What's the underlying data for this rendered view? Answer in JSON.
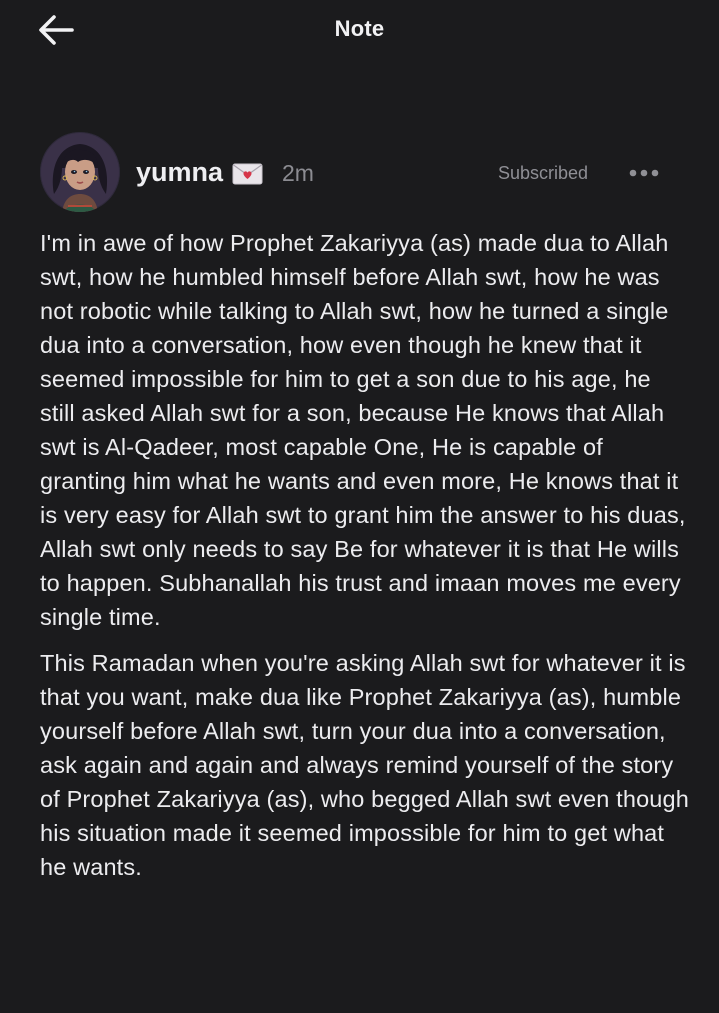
{
  "header": {
    "title": "Note",
    "back_icon": "arrow-left-icon"
  },
  "author": {
    "name": "yumna",
    "badge_icon": "love-letter-icon",
    "timestamp": "2m",
    "subscribed_label": "Subscribed",
    "more_icon": "more-horizontal-icon"
  },
  "note": {
    "paragraphs": [
      "I'm in awe of how Prophet Zakariyya (as) made dua to Allah swt, how he humbled himself before Allah swt, how he was not robotic while talking to Allah swt, how he turned a single dua into a conversation, how even though he knew that it seemed impossible for him to get a son due to his age, he still asked Allah swt for a son, because He knows that Allah swt is Al-Qadeer, most capable One, He is capable of granting him what he wants and even more, He knows that it is very easy for Allah swt to grant him the answer to his duas, Allah swt only needs to say Be for whatever it is that He wills to happen. Subhanallah his trust and imaan moves me every single time.",
      "This Ramadan when you're asking Allah swt for whatever it is that you want, make dua like Prophet Zakariyya (as), humble yourself before Allah swt, turn your dua into a conversation, ask again and again and always remind yourself of the story of Prophet Zakariyya (as), who begged Allah swt even though his situation made it seemed impossible for him to get what he wants."
    ]
  },
  "colors": {
    "background": "#1b1b1d",
    "text": "#ececef",
    "muted": "#8c8c92"
  }
}
